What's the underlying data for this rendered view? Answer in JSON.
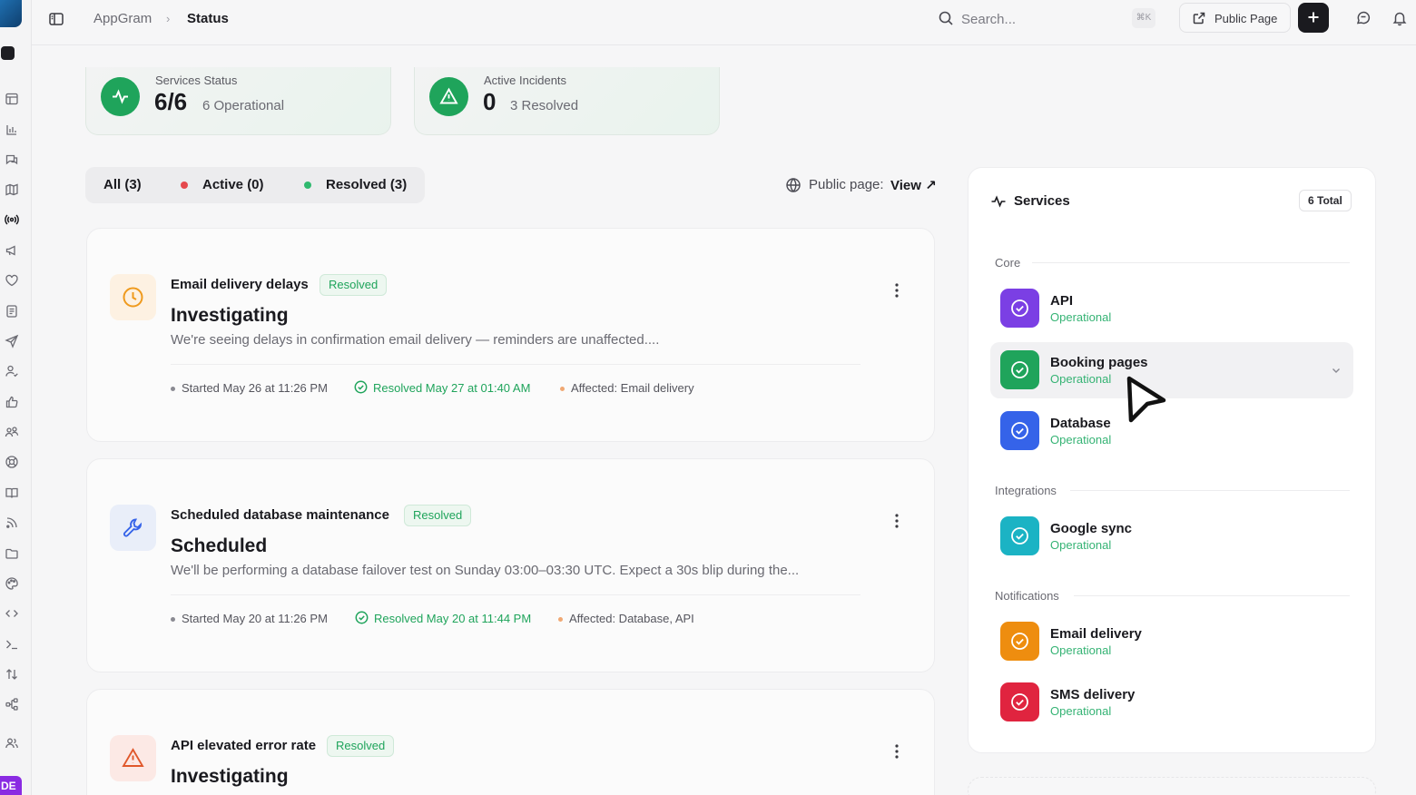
{
  "app": {
    "name": "AppGram",
    "page": "Status",
    "user_initials": "DE"
  },
  "topbar": {
    "search_placeholder": "Search...",
    "search_shortcut": "⌘K",
    "public_page_button": "Public Page"
  },
  "summary": {
    "services": {
      "caption": "Services Status",
      "value": "6/6",
      "sub": "6 Operational"
    },
    "incidents": {
      "caption": "Active Incidents",
      "value": "0",
      "sub": "3 Resolved"
    }
  },
  "filters": {
    "tabs": [
      {
        "label": "All (3)"
      },
      {
        "label": "Active (0)",
        "dot": "#e5484d"
      },
      {
        "label": "Resolved (3)",
        "dot": "#30b96f"
      }
    ],
    "public_page_label": "Public page:",
    "public_page_link": "View ↗"
  },
  "incidents": [
    {
      "title": "Email delivery delays",
      "badge": "Resolved",
      "state": "Investigating",
      "description": "We're seeing delays in confirmation email delivery — reminders are unaffected....",
      "started": "Started May 26 at 11:26 PM",
      "resolved": "Resolved May 27 at 01:40 AM",
      "affected": "Affected: Email delivery",
      "icon": "clock-icon"
    },
    {
      "title": "Scheduled database maintenance",
      "badge": "Resolved",
      "state": "Scheduled",
      "description": "We'll be performing a database failover test on Sunday 03:00–03:30 UTC. Expect a 30s blip during the...",
      "started": "Started May 20 at 11:26 PM",
      "resolved": "Resolved May 20 at 11:44 PM",
      "affected": "Affected: Database, API",
      "icon": "wrench-icon"
    },
    {
      "title": "API elevated error rate",
      "badge": "Resolved",
      "state": "Investigating",
      "icon": "warning-icon"
    }
  ],
  "services_panel": {
    "title": "Services",
    "total": "6 Total",
    "groups": [
      {
        "name": "Core",
        "items": [
          {
            "name": "API",
            "status": "Operational",
            "color": "#7b3fe4"
          },
          {
            "name": "Booking pages",
            "status": "Operational",
            "color": "#1fa45b"
          },
          {
            "name": "Database",
            "status": "Operational",
            "color": "#3563e9"
          }
        ]
      },
      {
        "name": "Integrations",
        "items": [
          {
            "name": "Google sync",
            "status": "Operational",
            "color": "#1bb3c4"
          }
        ]
      },
      {
        "name": "Notifications",
        "items": [
          {
            "name": "Email delivery",
            "status": "Operational",
            "color": "#ee8d0f"
          },
          {
            "name": "SMS delivery",
            "status": "Operational",
            "color": "#e0243f"
          }
        ]
      }
    ]
  },
  "colors": {
    "success": "#1fa45b",
    "warning_bg": "#fdf1e2",
    "info_bg": "#e9eef9",
    "danger_bg": "#fce9e5"
  }
}
